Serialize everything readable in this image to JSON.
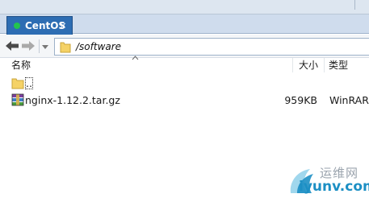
{
  "tab": {
    "label": "CentOS",
    "status_color": "#23c44d",
    "close_glyph": "×"
  },
  "pathbar": {
    "path": "/software"
  },
  "columns": {
    "name": "名称",
    "size": "大小",
    "type": "类型"
  },
  "files": [
    {
      "name": "..",
      "size": "",
      "type": "",
      "icon": "folder-icon"
    },
    {
      "name": "nginx-1.12.2.tar.gz",
      "size": "959KB",
      "type": "WinRAR",
      "icon": "winrar-archive-icon"
    }
  ],
  "watermark": {
    "line1": "运维网",
    "line2": "iyunv.com"
  },
  "colors": {
    "tab_active": "#2d6db3",
    "folder": "#f5d266"
  }
}
